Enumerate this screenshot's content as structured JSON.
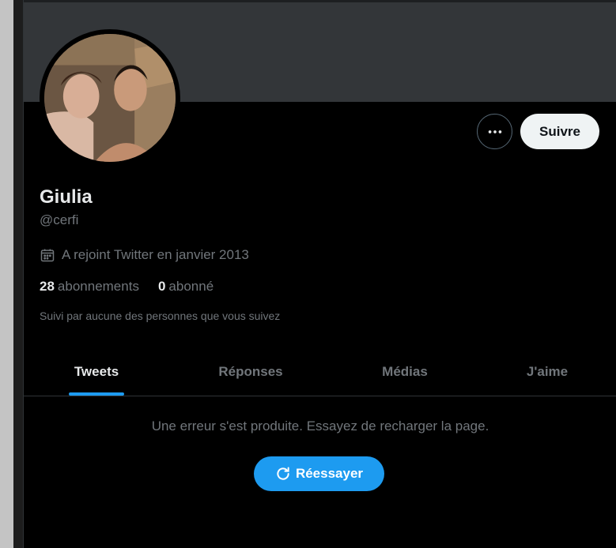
{
  "profile": {
    "name": "Giulia",
    "handle": "@cerfi",
    "joined": "A rejoint Twitter en janvier 2013",
    "following_count": "28",
    "following_label": "abonnements",
    "followers_count": "0",
    "followers_label": "abonné",
    "followed_by": "Suivi par aucune des personnes que vous suivez",
    "follow_button": "Suivre"
  },
  "tabs": [
    {
      "label": "Tweets",
      "active": true
    },
    {
      "label": "Réponses",
      "active": false
    },
    {
      "label": "Médias",
      "active": false
    },
    {
      "label": "J'aime",
      "active": false
    }
  ],
  "error": {
    "message": "Une erreur s'est produite. Essayez de recharger la page.",
    "retry_label": "Réessayer"
  },
  "colors": {
    "accent": "#1d9bf0",
    "background": "#000000",
    "banner": "#333639"
  },
  "icons": {
    "more": "more-horizontal-icon",
    "calendar": "calendar-icon",
    "refresh": "refresh-icon"
  }
}
